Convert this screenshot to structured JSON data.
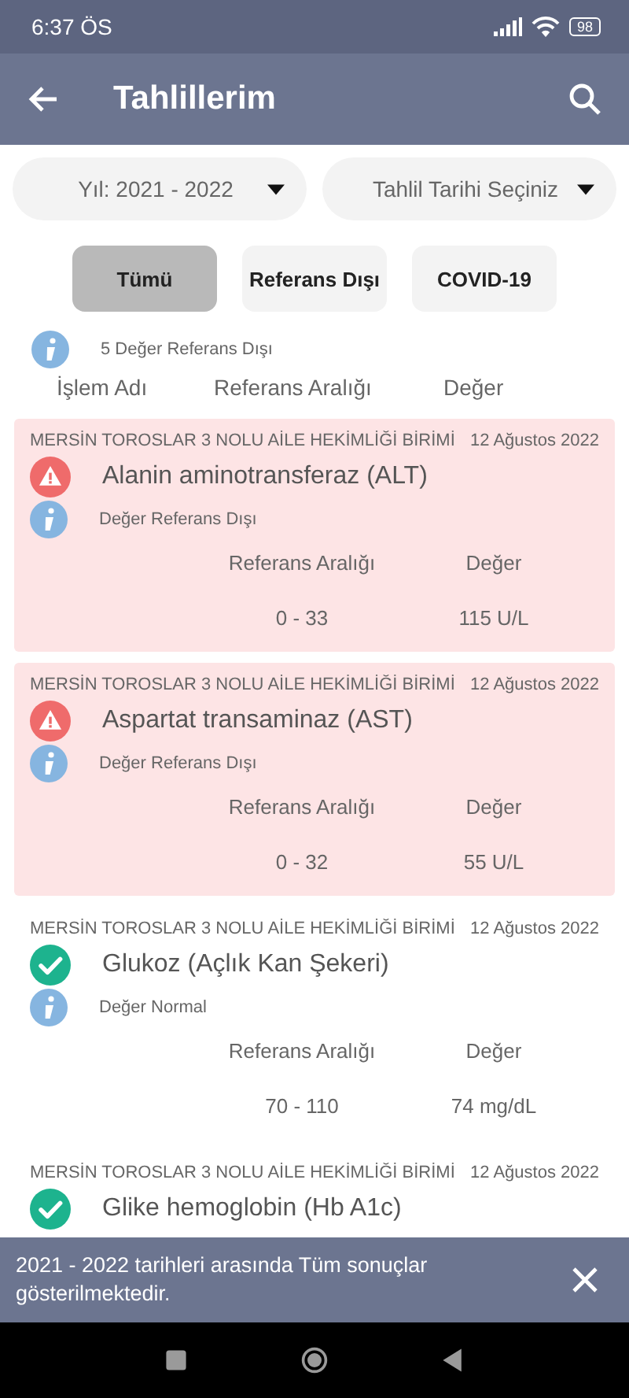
{
  "status_bar": {
    "time": "6:37 ÖS",
    "battery": "98"
  },
  "app_bar": {
    "title": "Tahlillerim"
  },
  "filters": [
    {
      "label": "Yıl: 2021 - 2022"
    },
    {
      "label": "Tahlil Tarihi Seçiniz"
    }
  ],
  "chips": [
    {
      "label": "Tümü",
      "selected": true
    },
    {
      "label": "Referans Dışı",
      "selected": false
    },
    {
      "label": "COVID-19",
      "selected": false
    }
  ],
  "summary": "5 Değer Referans Dışı",
  "columns": [
    "İşlem Adı",
    "Referans Aralığı",
    "Değer"
  ],
  "results": [
    {
      "kind": "abnormal",
      "facility": "MERSİN TOROSLAR 3 NOLU AİLE HEKİMLİĞİ BİRİMİ",
      "date": "12 Ağustos 2022",
      "name": "Alanin aminotransferaz (ALT)",
      "note": "Değer Referans Dışı",
      "range_label": "Referans Aralığı",
      "value_label": "Değer",
      "range": "0 - 33",
      "value": "115 U/L"
    },
    {
      "kind": "abnormal",
      "facility": "MERSİN TOROSLAR 3 NOLU AİLE HEKİMLİĞİ BİRİMİ",
      "date": "12 Ağustos 2022",
      "name": "Aspartat transaminaz (AST)",
      "note": "Değer Referans Dışı",
      "range_label": "Referans Aralığı",
      "value_label": "Değer",
      "range": "0 - 32",
      "value": "55 U/L"
    },
    {
      "kind": "normal",
      "facility": "MERSİN TOROSLAR 3 NOLU AİLE HEKİMLİĞİ BİRİMİ",
      "date": "12 Ağustos 2022",
      "name": "Glukoz (Açlık Kan Şekeri)",
      "note": "Değer Normal",
      "range_label": "Referans Aralığı",
      "value_label": "Değer",
      "range": "70 - 110",
      "value": "74 mg/dL"
    },
    {
      "kind": "normal",
      "facility": "MERSİN TOROSLAR 3 NOLU AİLE HEKİMLİĞİ BİRİMİ",
      "date": "12 Ağustos 2022",
      "name": "Glike hemoglobin (Hb A1c)"
    }
  ],
  "snackbar": {
    "message": "2021 - 2022 tarihleri arasında Tüm sonuçlar gösterilmektedir."
  }
}
